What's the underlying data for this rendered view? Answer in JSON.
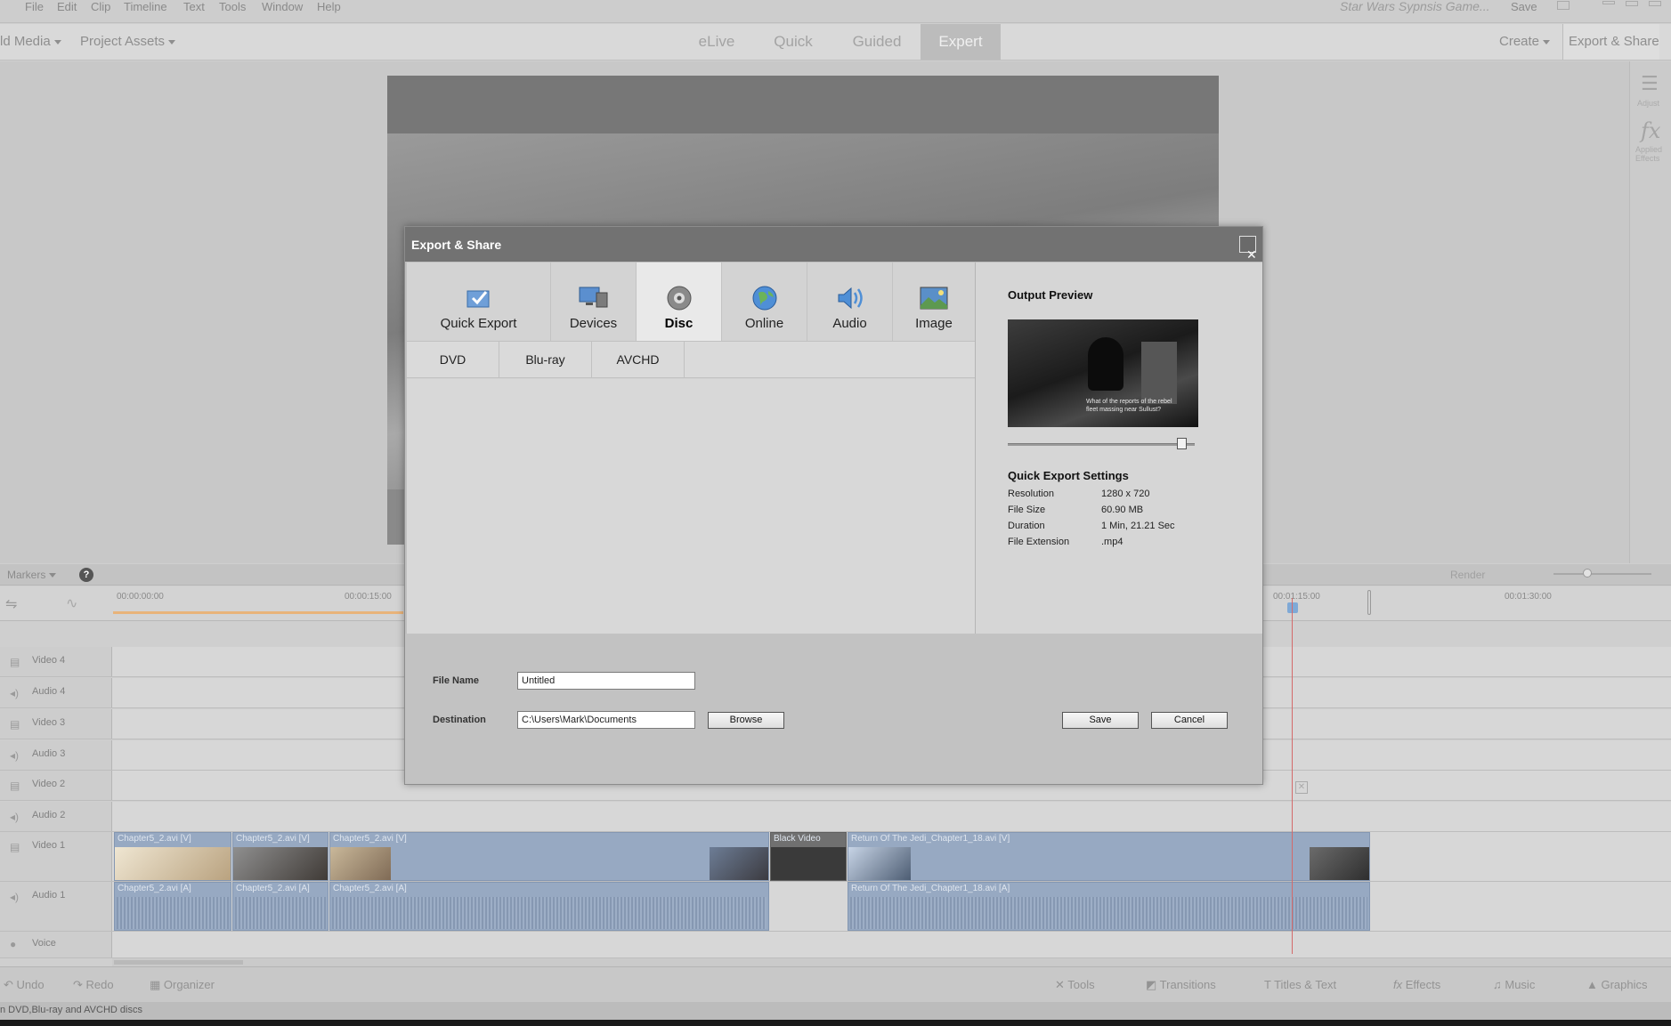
{
  "menu": {
    "items": [
      "File",
      "Edit",
      "Clip",
      "Timeline",
      "Text",
      "Tools",
      "Window",
      "Help"
    ],
    "project_title": "Star Wars Sypnsis Game...",
    "save_label": "Save"
  },
  "modebar": {
    "add_media": "ld Media",
    "project_assets": "Project Assets",
    "modes": [
      "eLive",
      "Quick",
      "Guided",
      "Expert"
    ],
    "active_mode": "Expert",
    "create": "Create",
    "export_share": "Export & Share"
  },
  "right_panel": {
    "adjust": "Adjust",
    "applied": "Applied Effects"
  },
  "timeline": {
    "markers": "Markers",
    "render": "Render",
    "ticks": [
      "00:00:00:00",
      "00:00:15:00",
      "00:01:15:00",
      "00:01:30:00"
    ],
    "tracks": [
      "Video 4",
      "Audio 4",
      "Video 3",
      "Audio 3",
      "Video 2",
      "Audio 2",
      "Video 1",
      "Audio 1",
      "Voice"
    ],
    "clips_video": [
      "Chapter5_2.avi [V]",
      "Chapter5_2.avi [V]",
      "Chapter5_2.avi [V]",
      "Black Video",
      "Return Of The Jedi_Chapter1_18.avi [V]"
    ],
    "clips_audio": [
      "Chapter5_2.avi [A]",
      "Chapter5_2.avi [A]",
      "Chapter5_2.avi [A]",
      "Return Of The Jedi_Chapter1_18.avi [A]"
    ]
  },
  "bottom_toolbar": {
    "undo": "Undo",
    "redo": "Redo",
    "organizer": "Organizer",
    "tools": "Tools",
    "transitions": "Transitions",
    "titles": "Titles & Text",
    "effects": "Effects",
    "music": "Music",
    "graphics": "Graphics"
  },
  "status_text": "n DVD,Blu-ray and AVCHD discs",
  "dialog": {
    "title": "Export & Share",
    "tabs": [
      "Quick Export",
      "Devices",
      "Disc",
      "Online",
      "Audio",
      "Image"
    ],
    "active_tab": "Disc",
    "subtabs": [
      "DVD",
      "Blu-ray",
      "AVCHD"
    ],
    "output_preview_title": "Output Preview",
    "preview_subtitle": "What of the reports of the rebel fleet massing near Sullust?",
    "preview_position": 0.93,
    "quick_export_title": "Quick Export Settings",
    "settings": [
      {
        "key": "Resolution",
        "value": "1280 x 720"
      },
      {
        "key": "File Size",
        "value": "60.90 MB"
      },
      {
        "key": "Duration",
        "value": "1 Min, 21.21 Sec"
      },
      {
        "key": "File Extension",
        "value": ".mp4"
      }
    ],
    "file_name_label": "File Name",
    "file_name_value": "Untitled",
    "destination_label": "Destination",
    "destination_value": "C:\\Users\\Mark\\Documents",
    "browse_label": "Browse",
    "save_label": "Save",
    "cancel_label": "Cancel",
    "close_glyph": "✕"
  }
}
